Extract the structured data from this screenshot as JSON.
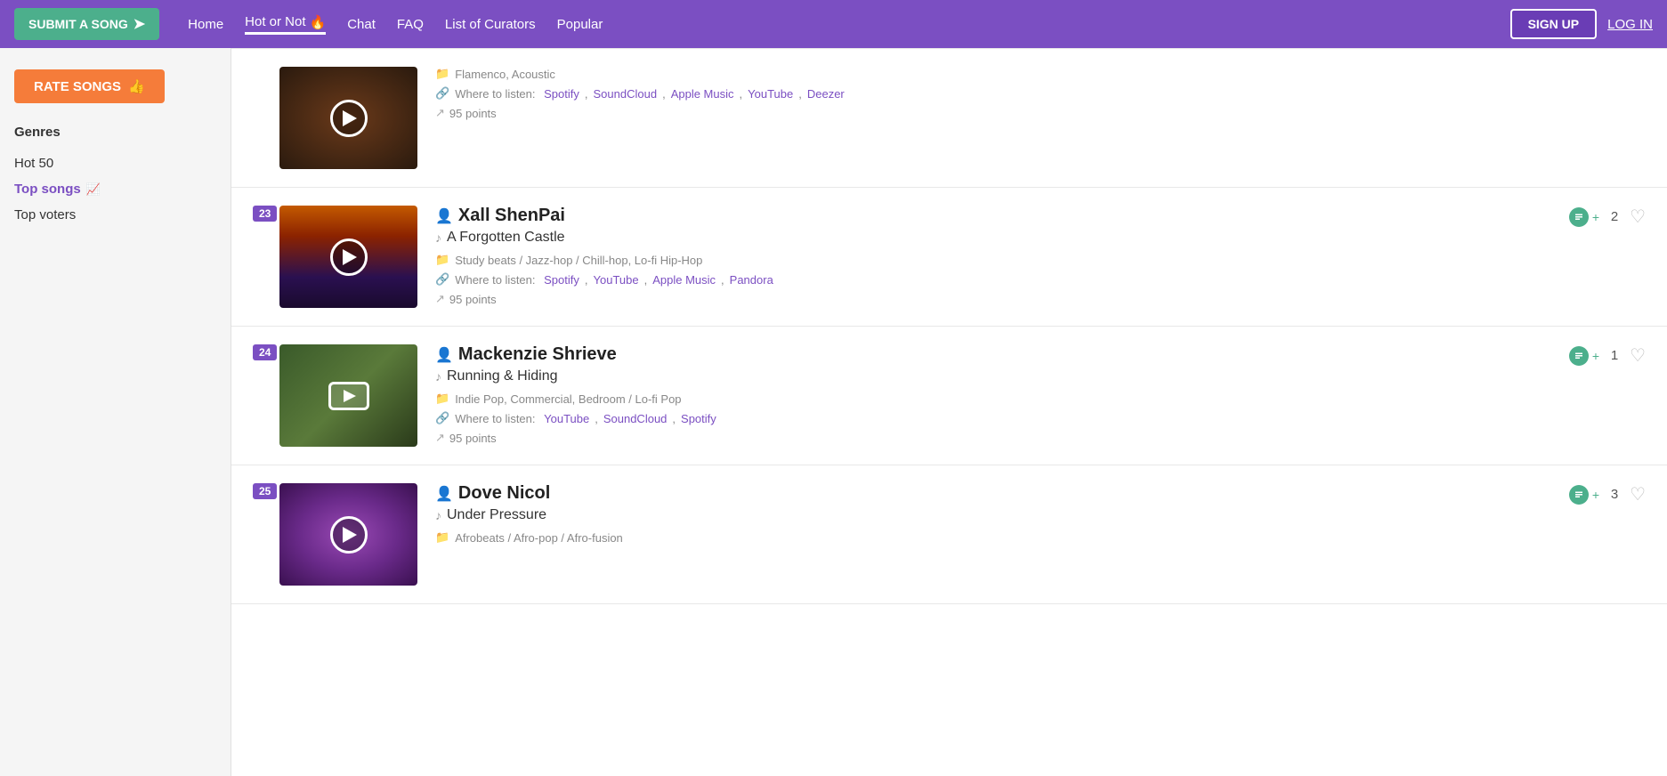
{
  "nav": {
    "submit_label": "SUBMIT A SONG",
    "home_label": "Home",
    "hot_or_not_label": "Hot or Not",
    "chat_label": "Chat",
    "faq_label": "FAQ",
    "curators_label": "List of Curators",
    "popular_label": "Popular",
    "signup_label": "SIGN UP",
    "login_label": "LOG IN"
  },
  "sidebar": {
    "rate_label": "RATE SONGS",
    "genres_label": "Genres",
    "hot50_label": "Hot 50",
    "top_songs_label": "Top songs",
    "top_voters_label": "Top voters"
  },
  "songs": [
    {
      "rank": null,
      "partial": true,
      "artist": "",
      "title": "",
      "genres": "Flamenco, Acoustic",
      "listen_label": "Where to listen:",
      "listen_links": [
        {
          "name": "Spotify",
          "url": "#"
        },
        {
          "name": "SoundCloud",
          "url": "#"
        },
        {
          "name": "Apple Music",
          "url": "#"
        },
        {
          "name": "YouTube",
          "url": "#"
        },
        {
          "name": "Deezer",
          "url": "#"
        }
      ],
      "points": "95 points",
      "vote_count": "",
      "thumb_color": "#2a1a0e",
      "show_actions": false
    },
    {
      "rank": "23",
      "partial": false,
      "artist": "Xall ShenPai",
      "title": "A Forgotten Castle",
      "genres": "Study beats / Jazz-hop / Chill-hop, Lo-fi Hip-Hop",
      "listen_label": "Where to listen:",
      "listen_links": [
        {
          "name": "Spotify",
          "url": "#"
        },
        {
          "name": "YouTube",
          "url": "#"
        },
        {
          "name": "Apple Music",
          "url": "#"
        },
        {
          "name": "Pandora",
          "url": "#"
        }
      ],
      "points": "95 points",
      "vote_count": "2",
      "thumb_color_top": "#c45a00",
      "thumb_color_bottom": "#1a0a2e",
      "show_actions": true
    },
    {
      "rank": "24",
      "partial": false,
      "artist": "Mackenzie Shrieve",
      "title": "Running & Hiding",
      "genres": "Indie Pop, Commercial, Bedroom / Lo-fi Pop",
      "listen_label": "Where to listen:",
      "listen_links": [
        {
          "name": "YouTube",
          "url": "#"
        },
        {
          "name": "SoundCloud",
          "url": "#"
        },
        {
          "name": "Spotify",
          "url": "#"
        }
      ],
      "points": "95 points",
      "vote_count": "1",
      "thumb_color": "#3a5a2a",
      "show_actions": true
    },
    {
      "rank": "25",
      "partial": false,
      "artist": "Dove Nicol",
      "title": "Under Pressure",
      "genres": "Afrobeats / Afro-pop / Afro-fusion",
      "listen_label": "",
      "listen_links": [],
      "points": "",
      "vote_count": "3",
      "thumb_color": "#6a3a8a",
      "show_actions": true
    }
  ]
}
